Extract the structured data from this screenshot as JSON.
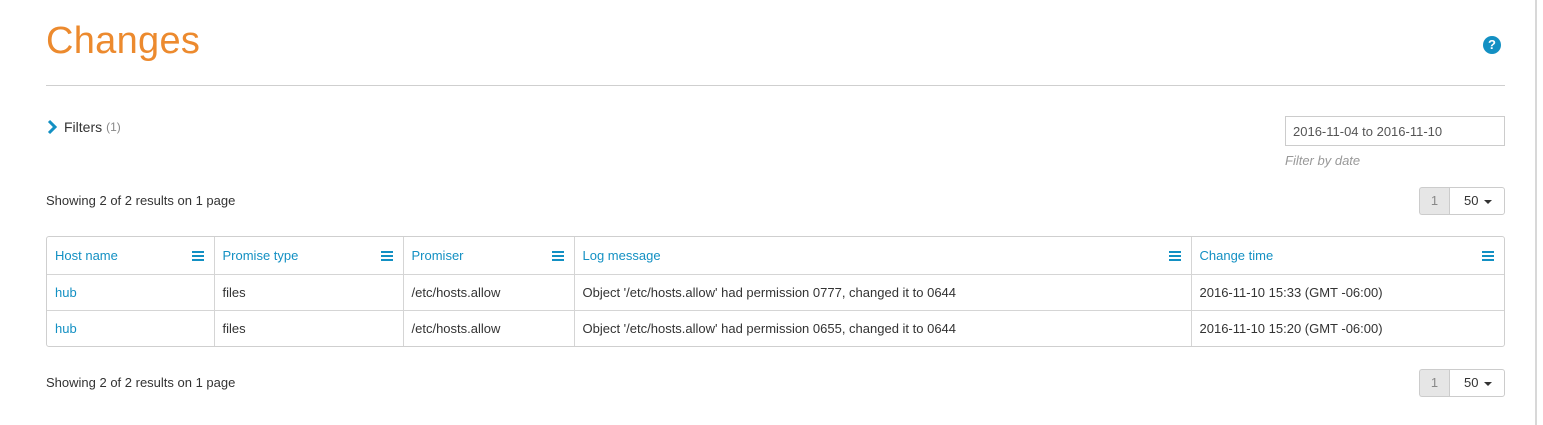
{
  "header": {
    "title": "Changes",
    "help_icon": "question-circle-icon"
  },
  "filters": {
    "label": "Filters",
    "count": "(1)",
    "icon": "chevron-right-icon"
  },
  "date_filter": {
    "value": "2016-11-04 to 2016-11-10",
    "hint": "Filter by date"
  },
  "summary": {
    "top": "Showing 2 of 2 results on 1 page",
    "bottom": "Showing 2 of 2 results on 1 page"
  },
  "pagination": {
    "current_page": "1",
    "page_size": "50"
  },
  "table": {
    "columns": [
      "Host name",
      "Promise type",
      "Promiser",
      "Log message",
      "Change time"
    ],
    "rows": [
      {
        "host": "hub",
        "type": "files",
        "promiser": "/etc/hosts.allow",
        "message": "Object '/etc/hosts.allow' had permission 0777, changed it to 0644",
        "time": "2016-11-10 15:33 (GMT -06:00)"
      },
      {
        "host": "hub",
        "type": "files",
        "promiser": "/etc/hosts.allow",
        "message": "Object '/etc/hosts.allow' had permission 0655, changed it to 0644",
        "time": "2016-11-10 15:20 (GMT -06:00)"
      }
    ]
  },
  "colors": {
    "accent": "#1390c3",
    "title": "#ec8a2e"
  }
}
